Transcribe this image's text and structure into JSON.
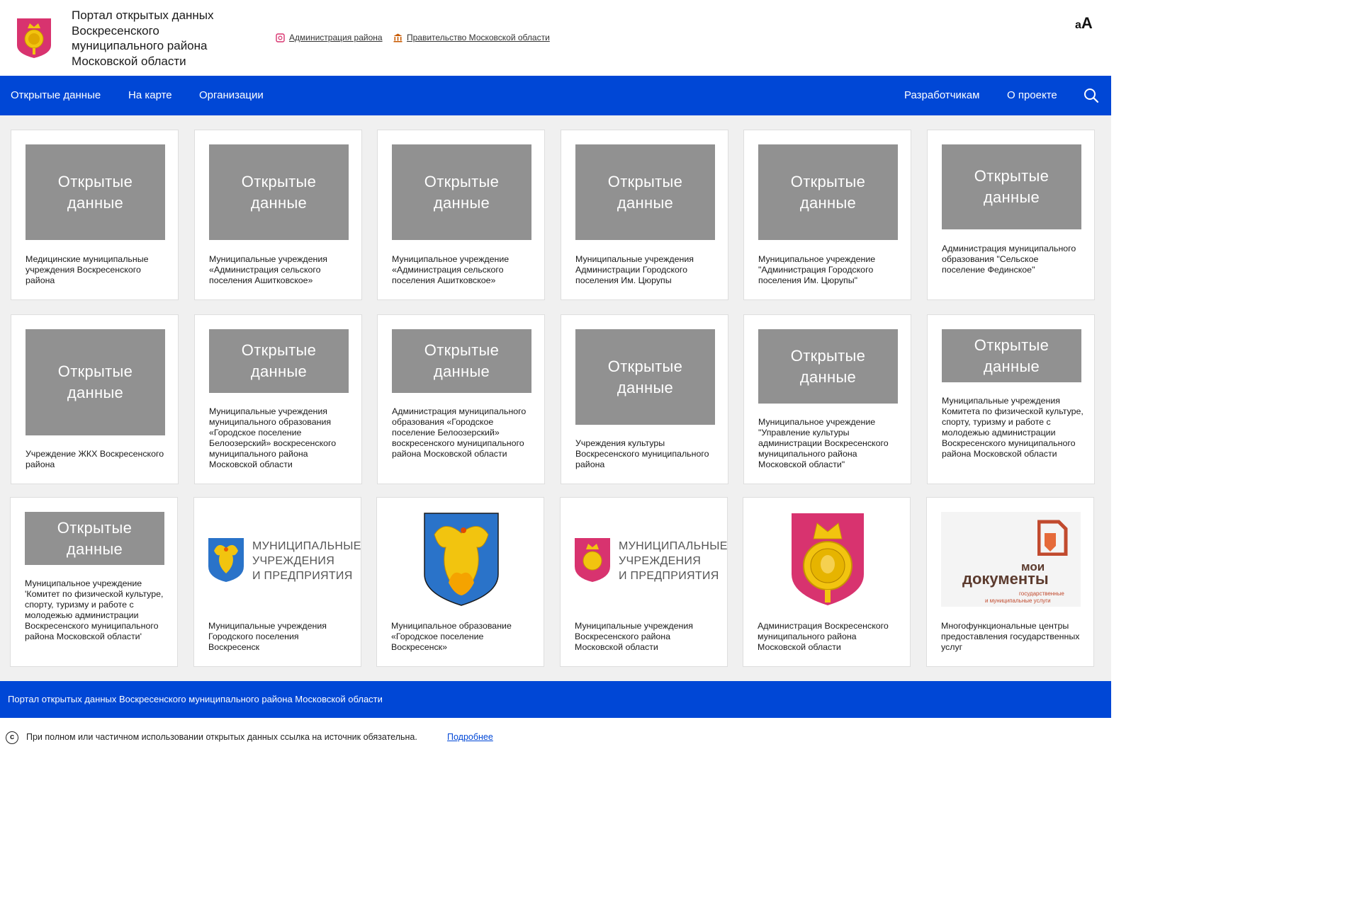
{
  "header": {
    "title": "Портал открытых данных Воскресенского муниципального района Московской области",
    "links": [
      {
        "label": "Администрация района",
        "icon": "admin-icon"
      },
      {
        "label": "Правительство Московской области",
        "icon": "government-building-icon"
      }
    ],
    "font_toggle": {
      "small": "а",
      "big": "А"
    }
  },
  "nav": {
    "left": [
      "Открытые данные",
      "На карте",
      "Организации"
    ],
    "right": [
      "Разработчикам",
      "О проекте"
    ],
    "search_icon": "search-icon"
  },
  "placeholder_text": {
    "line1": "Открытые",
    "line2": "данные"
  },
  "cards": [
    {
      "caption": "Медицинские муниципальные учреждения Воскресенского района"
    },
    {
      "caption": "Муниципальные учреждения «Администрация сельского поселения Ашитковское»"
    },
    {
      "caption": "Муниципальное учреждение «Администрация сельского поселения Ашитковское»"
    },
    {
      "caption": "Муниципальные учреждения Администрации Городского поселения Им. Цюрупы"
    },
    {
      "caption": "Муниципальное учреждение \"Администрация Городского поселения Им. Цюрупы\""
    },
    {
      "caption": "Администрация муниципального образования \"Сельское поселение Фединское\""
    },
    {
      "caption": "Учреждение ЖКХ Воскресенского района"
    },
    {
      "caption": "Муниципальные учреждения муниципального образования «Городское поселение Белоозерский» воскресенского муниципального района Московской области"
    },
    {
      "caption": "Администрация муниципального образования «Городское поселение Белоозерский» воскресенского муниципального района Московской области"
    },
    {
      "caption": "Учреждения культуры Воскресенского муниципального района"
    },
    {
      "caption": "Муниципальное учреждение \"Управление культуры администрации Воскресенского муниципального района Московской области\""
    },
    {
      "caption": "Муниципальные учреждения Комитета по физической культуре, спорту, туризму и работе с молодежью администрации Воскресенского муниципального района Московской области"
    },
    {
      "caption": "Муниципальное учреждение 'Комитет по физической культуре, спорту, туризму и работе с молодежью администрации Воскресенского муниципального района Московской области'"
    },
    {
      "caption": "Муниципальные учреждения Городского поселения Воскресенск",
      "logo_text": [
        "МУНИЦИПАЛЬНЫЕ",
        "УЧРЕЖДЕНИЯ",
        "И ПРЕДПРИЯТИЯ"
      ]
    },
    {
      "caption": "Муниципальное образование «Городское поселение Воскресенск»"
    },
    {
      "caption": "Муниципальные учреждения Воскресенского района Московской области",
      "logo_text": [
        "МУНИЦИПАЛЬНЫЕ",
        "УЧРЕЖДЕНИЯ",
        "И ПРЕДПРИЯТИЯ"
      ]
    },
    {
      "caption": "Администрация Воскресенского муниципального района Московской области"
    },
    {
      "caption": "Многофункциональные центры предоставления государственных услуг",
      "logo_text": [
        "мои",
        "документы",
        "государственные",
        "и муниципальные услуги"
      ]
    }
  ],
  "footer": {
    "title": "Портал открытых данных Воскресенского муниципального района Московской области",
    "copyright_symbol": "c",
    "copyright_text": "При полном или частичном использовании открытых данных ссылка на источник обязательна.",
    "more_link": "Подробнее"
  },
  "colors": {
    "brand_blue": "#0047d6",
    "placeholder_gray": "#919191",
    "crest_pink": "#d8336f",
    "crest_gold": "#f2c40f"
  }
}
